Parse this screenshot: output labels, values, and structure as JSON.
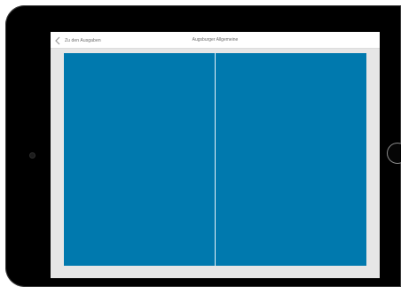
{
  "header": {
    "back_label": "Zu den Ausgaben",
    "title": "Augsburger Allgemeine"
  },
  "icons": {
    "back": "chevron-left-icon"
  },
  "colors": {
    "page_fill": "#0079ae",
    "device_frame": "#000000",
    "screen_background": "#e6e6e6"
  }
}
